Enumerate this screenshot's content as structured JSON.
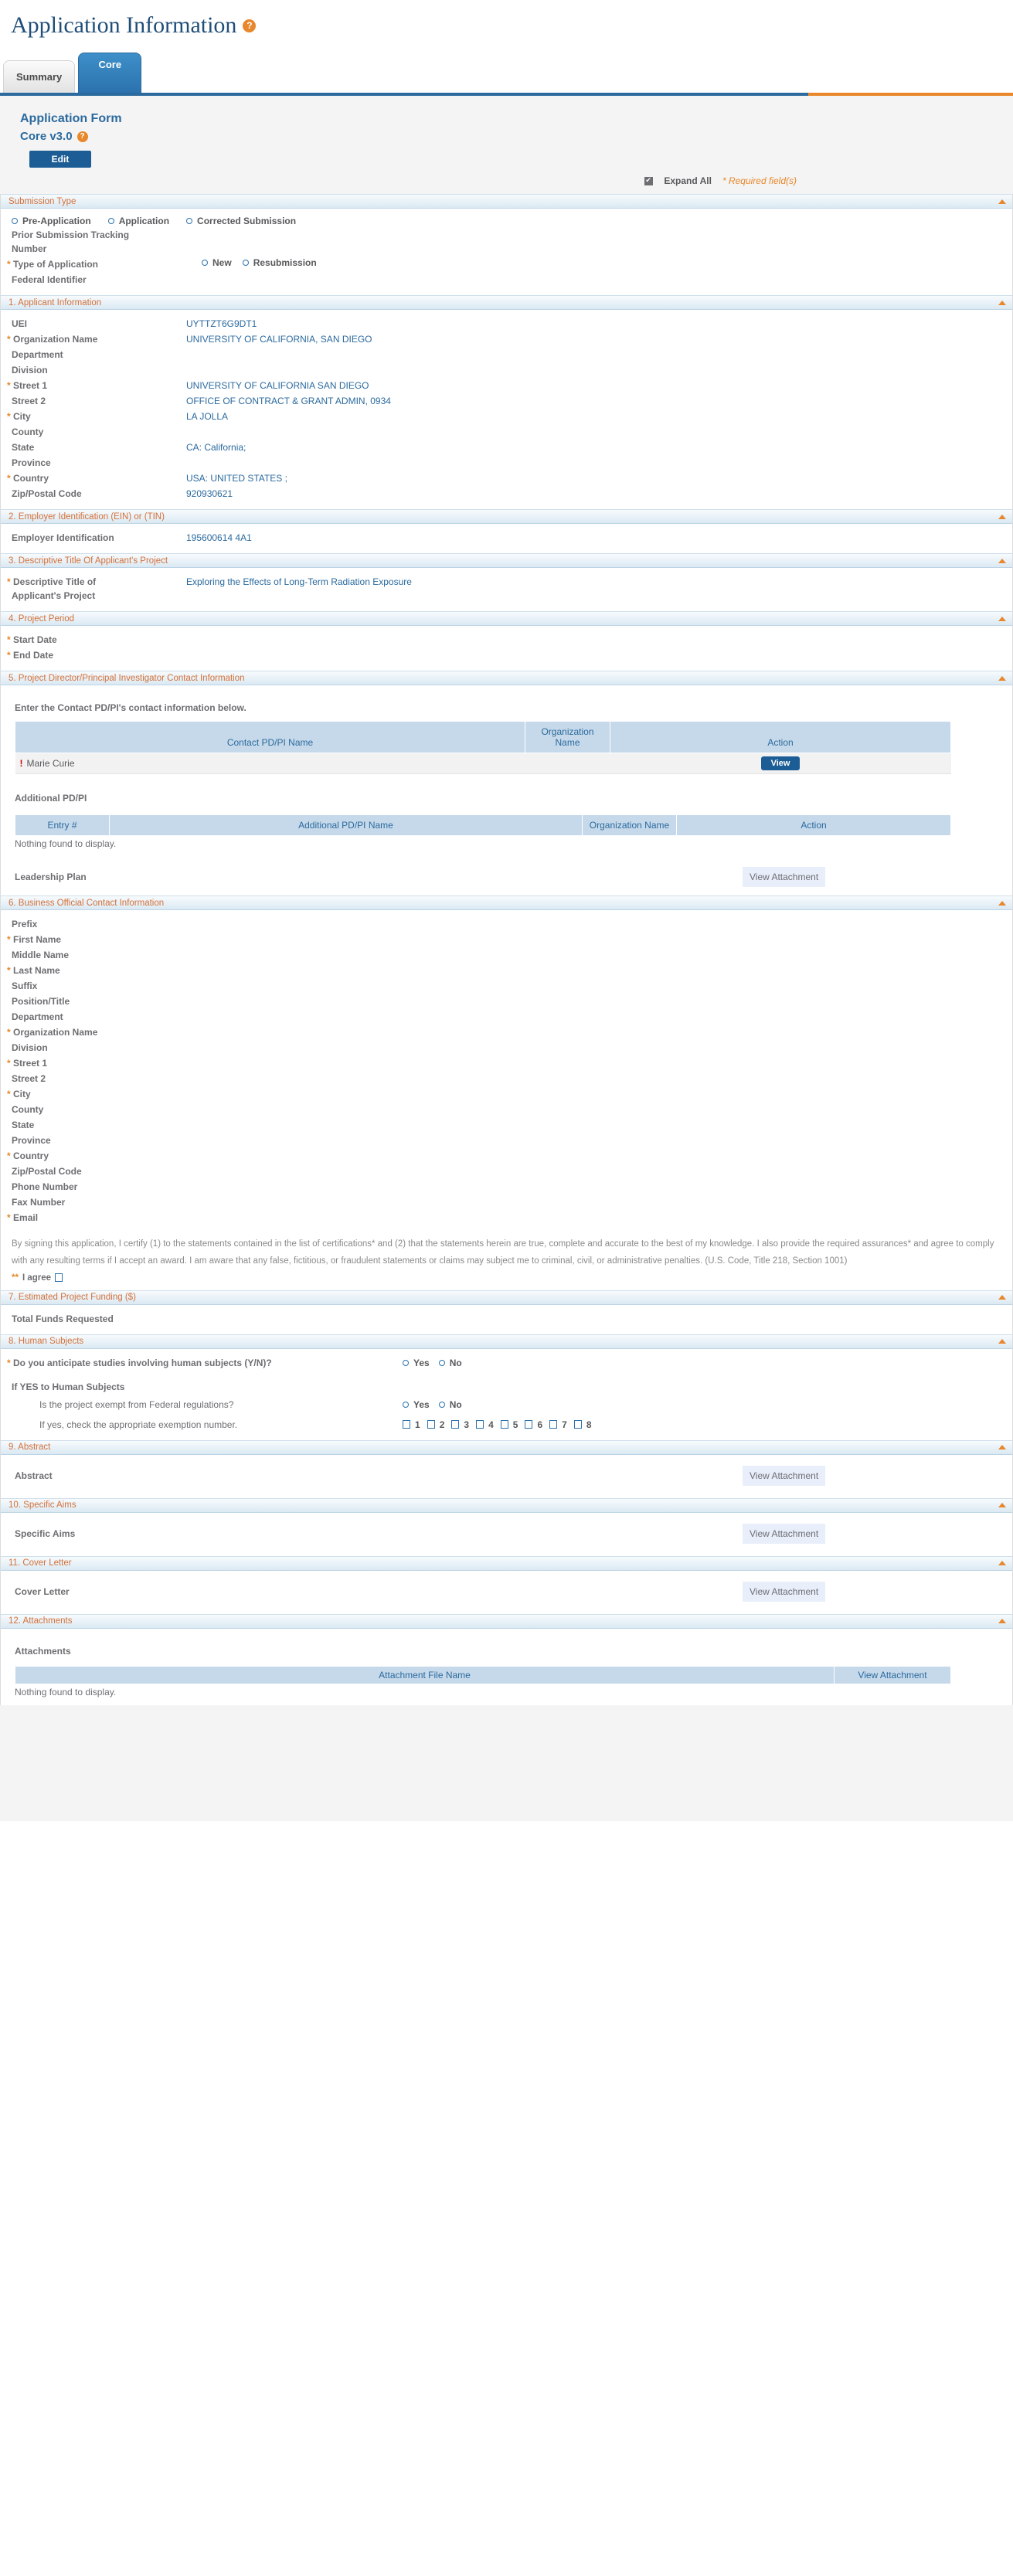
{
  "page": {
    "title": "Application Information",
    "help_icon": "question-mark-icon",
    "help_glyph": "?"
  },
  "tabs": [
    {
      "label": "Summary",
      "active": false
    },
    {
      "label": "Core",
      "active": true
    }
  ],
  "form": {
    "title": "Application Form",
    "version": "Core v3.0",
    "edit_label": "Edit",
    "expand_all_label": "Expand All",
    "expand_all_checked": true,
    "required_note": "* Required field(s)",
    "accent_orange": "#e8872b",
    "accent_blue": "#2b6a9e"
  },
  "sections": {
    "submission_type": {
      "title": "Submission Type",
      "options": [
        "Pre-Application",
        "Application",
        "Corrected Submission"
      ],
      "prior_tracking_label_l1": "Prior Submission Tracking",
      "prior_tracking_label_l2": "Number",
      "type_of_application_label": "Type of Application",
      "type_options": [
        "New",
        "Resubmission"
      ],
      "federal_identifier_label": "Federal Identifier"
    },
    "applicant_information": {
      "title": "1. Applicant Information",
      "fields": [
        {
          "label": "UEI",
          "required": false,
          "value": "UYTTZT6G9DT1"
        },
        {
          "label": "Organization Name",
          "required": true,
          "value": "UNIVERSITY OF CALIFORNIA, SAN DIEGO"
        },
        {
          "label": "Department",
          "required": false,
          "value": ""
        },
        {
          "label": "Division",
          "required": false,
          "value": ""
        },
        {
          "label": "Street 1",
          "required": true,
          "value": "UNIVERSITY OF CALIFORNIA SAN DIEGO"
        },
        {
          "label": "Street 2",
          "required": false,
          "value": "OFFICE OF CONTRACT & GRANT ADMIN, 0934"
        },
        {
          "label": "City",
          "required": true,
          "value": "LA JOLLA"
        },
        {
          "label": "County",
          "required": false,
          "value": ""
        },
        {
          "label": "State",
          "required": false,
          "value": "CA: California;"
        },
        {
          "label": "Province",
          "required": false,
          "value": ""
        },
        {
          "label": "Country",
          "required": true,
          "value": "USA: UNITED STATES ;"
        },
        {
          "label": "Zip/Postal Code",
          "required": false,
          "value": "920930621"
        }
      ]
    },
    "employer_identification": {
      "title": "2. Employer Identification (EIN) or (TIN)",
      "fields": [
        {
          "label": "Employer Identification",
          "required": false,
          "value": "195600614 4A1"
        }
      ]
    },
    "descriptive_title": {
      "title": "3. Descriptive Title Of Applicant's Project",
      "label_line1": "Descriptive Title of",
      "label_line2": "Applicant's Project",
      "value": "Exploring the Effects of Long-Term Radiation Exposure"
    },
    "project_period": {
      "title": "4. Project Period",
      "fields": [
        {
          "label": "Start Date",
          "required": true,
          "value": ""
        },
        {
          "label": "End Date",
          "required": true,
          "value": ""
        }
      ]
    },
    "pdpi": {
      "title": "5. Project Director/Principal Investigator Contact Information",
      "instruction": "Enter the Contact PD/PI's contact information below.",
      "contact_table": {
        "headers": [
          "Contact PD/PI Name",
          "Organization Name",
          "Action"
        ],
        "rows": [
          {
            "name": "Marie Curie",
            "flag": "!",
            "organization": "",
            "action": "View"
          }
        ]
      },
      "additional_label": "Additional PD/PI",
      "additional_table": {
        "headers": [
          "Entry #",
          "Additional PD/PI Name",
          "Organization Name",
          "Action"
        ],
        "empty_message": "Nothing found to display."
      },
      "leadership_plan_label": "Leadership Plan",
      "leadership_plan_button": "View Attachment"
    },
    "business_official": {
      "title": "6. Business Official Contact Information",
      "fields": [
        {
          "label": "Prefix",
          "required": false
        },
        {
          "label": "First Name",
          "required": true
        },
        {
          "label": "Middle Name",
          "required": false
        },
        {
          "label": "Last Name",
          "required": true
        },
        {
          "label": "Suffix",
          "required": false
        },
        {
          "label": "Position/Title",
          "required": false
        },
        {
          "label": "Department",
          "required": false
        },
        {
          "label": "Organization Name",
          "required": true
        },
        {
          "label": "Division",
          "required": false
        },
        {
          "label": " Street 1",
          "required": true
        },
        {
          "label": "Street 2",
          "required": false
        },
        {
          "label": "City",
          "required": true
        },
        {
          "label": "County",
          "required": false
        },
        {
          "label": "State",
          "required": false
        },
        {
          "label": "Province",
          "required": false
        },
        {
          "label": "Country",
          "required": true
        },
        {
          "label": "Zip/Postal Code",
          "required": false
        },
        {
          "label": "Phone Number",
          "required": false
        },
        {
          "label": "Fax Number",
          "required": false
        },
        {
          "label": "Email",
          "required": true
        }
      ],
      "certification": "By signing this application, I certify (1) to the statements contained in the list of certifications* and (2) that the statements herein are true, complete and accurate to the best of my knowledge. I also provide the required assurances* and agree to comply with any resulting terms if I accept an award. I am aware that any false, fictitious, or fraudulent statements or claims may subject me to criminal, civil, or administrative penalties. (U.S. Code, Title 218, Section 1001)",
      "agree_stars": "**",
      "agree_label": "I agree"
    },
    "estimated_funding": {
      "title": "7. Estimated Project Funding ($)",
      "fields": [
        {
          "label": "Total Funds Requested",
          "required": false
        }
      ]
    },
    "human_subjects": {
      "title": "8. Human Subjects",
      "question": "Do you anticipate studies involving human subjects (Y/N)?",
      "question_required": true,
      "yes_no": [
        "Yes",
        "No"
      ],
      "if_yes_header": "If YES to Human Subjects",
      "exempt_question": "Is the project exempt from Federal regulations?",
      "exempt_yes_no": [
        "Yes",
        "No"
      ],
      "exemption_label": "If yes, check the appropriate exemption number.",
      "exemption_numbers": [
        "1",
        "2",
        "3",
        "4",
        "5",
        "6",
        "7",
        "8"
      ]
    },
    "abstract": {
      "title": "9. Abstract",
      "label": "Abstract",
      "button": "View Attachment"
    },
    "specific_aims": {
      "title": "10. Specific Aims",
      "label": "Specific Aims",
      "button": "View Attachment"
    },
    "cover_letter": {
      "title": "11. Cover Letter",
      "label": "Cover Letter",
      "button": "View Attachment"
    },
    "attachments": {
      "title": "12. Attachments",
      "label": "Attachments",
      "headers": [
        "Attachment File Name",
        "View Attachment"
      ],
      "empty_message": "Nothing found to display."
    }
  }
}
